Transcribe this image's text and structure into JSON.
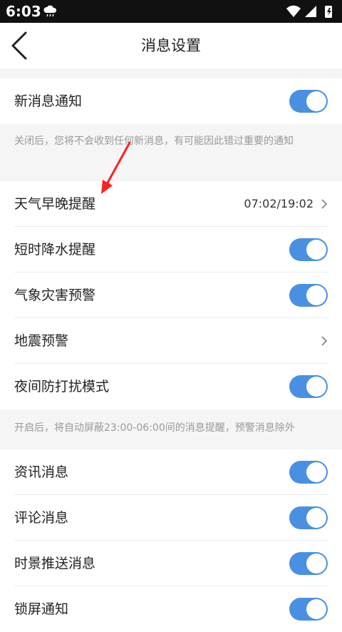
{
  "status_bar": {
    "time": "6:03"
  },
  "header": {
    "title": "消息设置"
  },
  "sections": [
    {
      "rows": [
        {
          "label": "新消息通知",
          "control": "toggle",
          "on": true
        }
      ],
      "note": "关闭后，您将不会收到任何新消息，有可能因此错过重要的通知"
    },
    {
      "rows": [
        {
          "label": "天气早晚提醒",
          "control": "value",
          "value": "07:02/19:02"
        },
        {
          "label": "短时降水提醒",
          "control": "toggle",
          "on": true
        },
        {
          "label": "气象灾害预警",
          "control": "toggle",
          "on": true
        },
        {
          "label": "地震预警",
          "control": "chevron"
        },
        {
          "label": "夜间防打扰模式",
          "control": "toggle",
          "on": true
        }
      ],
      "note": "开启后，将自动屏蔽23:00-06:00间的消息提醒，预警消息除外"
    },
    {
      "rows": [
        {
          "label": "资讯消息",
          "control": "toggle",
          "on": true
        },
        {
          "label": "评论消息",
          "control": "toggle",
          "on": true
        },
        {
          "label": "时景推送消息",
          "control": "toggle",
          "on": true
        },
        {
          "label": "锁屏通知",
          "control": "toggle",
          "on": true
        }
      ]
    }
  ],
  "colors": {
    "accent": "#4a90e2",
    "annotation": "#ff2020",
    "background": "#f5f5f5"
  }
}
